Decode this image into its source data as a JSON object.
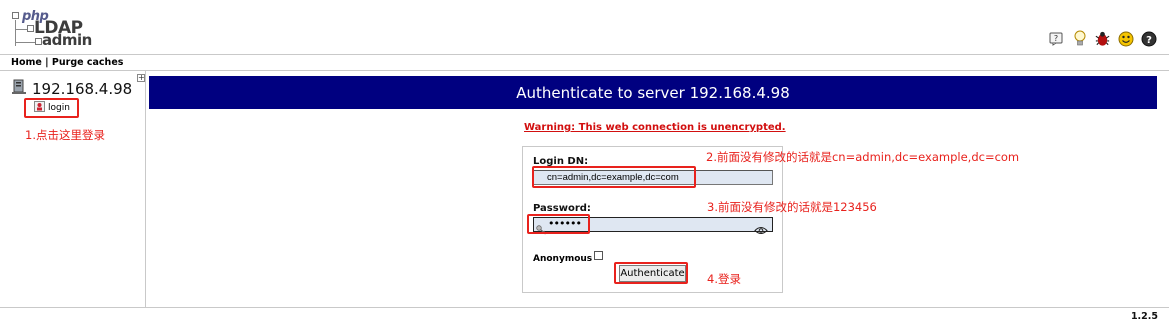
{
  "app": {
    "logo": {
      "php": "php",
      "ldap": "LDAP",
      "admin": "admin"
    },
    "toolbar_icons": [
      "help-icon",
      "lightbulb-icon",
      "bug-icon",
      "smiley-icon",
      "info-icon"
    ]
  },
  "menu": {
    "home": "Home",
    "separator": " | ",
    "purge": "Purge caches"
  },
  "tree": {
    "server": "192.168.4.98",
    "expand": "+",
    "login_item": "login",
    "annotation_1": "1.点击这里登录"
  },
  "main": {
    "title": "Authenticate to server 192.168.4.98",
    "warning": "Warning: This web connection is unencrypted.",
    "login_dn_label": "Login DN:",
    "login_dn_value": "cn=admin,dc=example,dc=com",
    "password_label": "Password:",
    "password_mask": "••••••",
    "anonymous_label": "Anonymous",
    "anonymous_checked": false,
    "authenticate_button": "Authenticate",
    "annotation_2": "2.前面没有修改的话就是cn=admin,dc=example,dc=com",
    "annotation_3": "3.前面没有修改的话就是123456",
    "annotation_4": "4.登录"
  },
  "footer": {
    "version": "1.2.5"
  },
  "colors": {
    "title_bar": "#000080",
    "annotation": "#e8221d",
    "warning": "#d20f0f",
    "input_bg": "#dfe7f2"
  }
}
